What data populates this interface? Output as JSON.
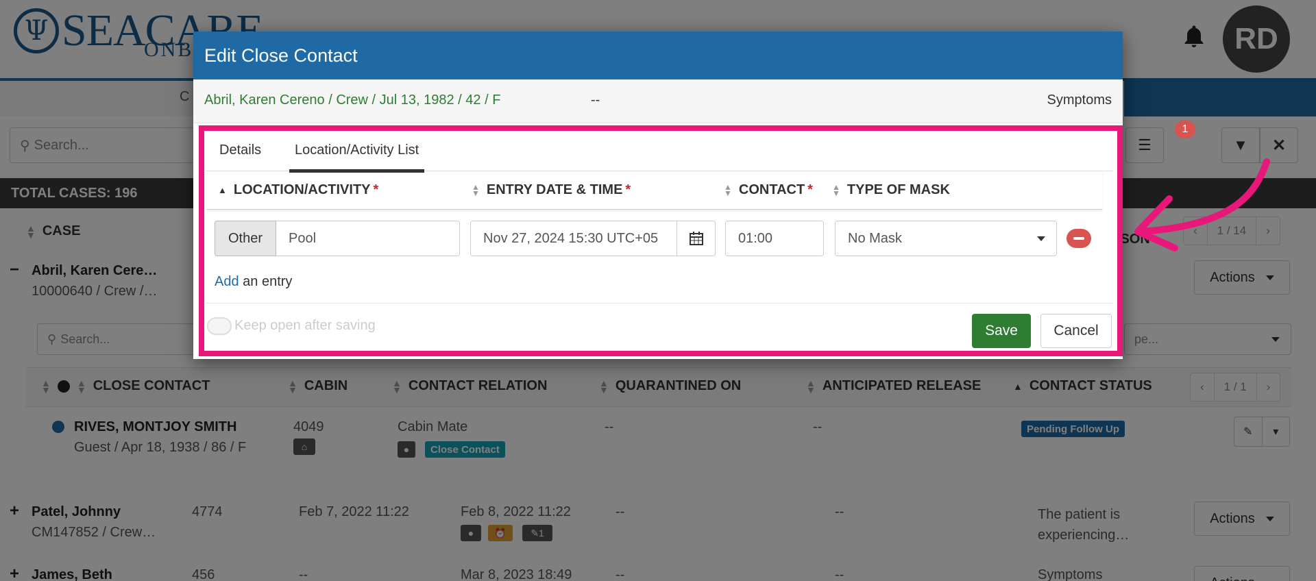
{
  "app": {
    "logo_text": "SEACARE",
    "logo_sub": "ONBOARD",
    "user_initials": "RD",
    "nav_partial": "C"
  },
  "toolbar": {
    "search_placeholder": "Search...",
    "filter_badge": "1"
  },
  "cases": {
    "total_label": "TOTAL CASES: 196",
    "header_case": "CASE",
    "header_reason_partial": "ASON",
    "pager_text": "1 / 14",
    "actions_label": "Actions",
    "rows": [
      {
        "name": "Abril, Karen Cere…",
        "sub": "10000640 / Crew /…",
        "toggle": "−"
      },
      {
        "name": "Patel, Johnny",
        "sub": "CM147852 / Crew…",
        "toggle": "+",
        "cabin": "4774",
        "date1": "Feb 7, 2022 11:22",
        "date2": "Feb 8, 2022 11:22",
        "dash1": "--",
        "dash2": "--",
        "reason": "The patient is experiencing…",
        "attach_count": "1"
      },
      {
        "name": "James, Beth",
        "sub": "",
        "toggle": "+",
        "cabin": "456",
        "date1": "--",
        "date2": "Mar 8, 2023 18:49",
        "dash1": "--",
        "dash2": "--",
        "reason": "Symptoms"
      }
    ]
  },
  "close_contacts": {
    "search_placeholder": "Search...",
    "select_placeholder": "pe...",
    "headers": [
      "CLOSE CONTACT",
      "CABIN",
      "CONTACT RELATION",
      "QUARANTINED ON",
      "ANTICIPATED RELEASE",
      "CONTACT STATUS"
    ],
    "pager_text": "1 / 1",
    "row": {
      "name": "RIVES, MONTJOY SMITH",
      "sub": "Guest / Apr 18, 1938 / 86 / F",
      "cabin": "4049",
      "relation": "Cabin Mate",
      "relation_tag": "Close Contact",
      "quarantined": "--",
      "release": "--",
      "status": "Pending Follow Up"
    }
  },
  "modal": {
    "title": "Edit Close Contact",
    "patient": "Abril, Karen Cereno / Crew / Jul 13, 1982 / 42 / F",
    "patient_dash": "--",
    "patient_symptoms": "Symptoms",
    "tabs": [
      {
        "label": "Details",
        "active": false
      },
      {
        "label": "Location/Activity List",
        "active": true
      }
    ],
    "columns": {
      "location": "LOCATION/ACTIVITY",
      "entry": "ENTRY DATE & TIME",
      "contact": "CONTACT",
      "mask": "TYPE OF MASK",
      "required_mark": "*"
    },
    "entry": {
      "type_button": "Other",
      "location_value": "Pool",
      "datetime_value": "Nov 27, 2024 15:30 UTC+05",
      "contact_value": "01:00",
      "mask_value": "No Mask"
    },
    "add_link": "Add",
    "add_text": " an entry",
    "keep_open": "Keep open after saving",
    "save": "Save",
    "cancel": "Cancel"
  },
  "colors": {
    "primary": "#1f6aa5",
    "success": "#2e7d32",
    "danger": "#d9534f",
    "highlight": "#e8177a",
    "patient_text": "#2e7d32"
  }
}
